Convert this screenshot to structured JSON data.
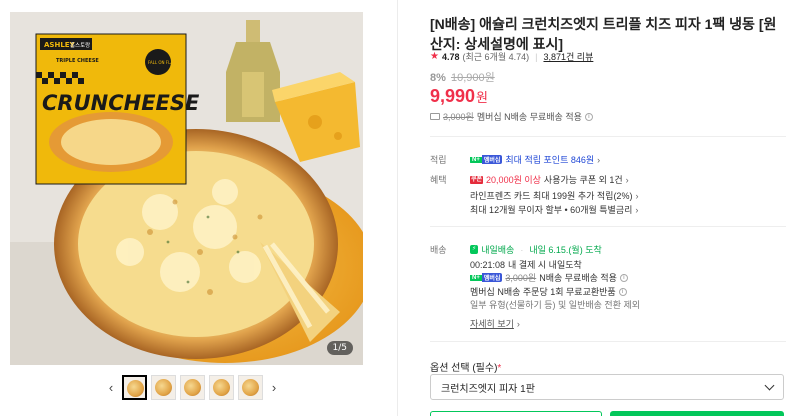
{
  "gallery": {
    "counter": "1/5",
    "prev_icon": "chevron-left-icon",
    "next_icon": "chevron-right-icon",
    "package_brand": "ASHLEY",
    "package_brand_kr": "홈스토랑",
    "package_tag": "TRIPLE CHEESE",
    "package_badge": "FALL ON FLAVOR",
    "package_name": "CRUNCHEESE"
  },
  "product": {
    "title": "[N배송] 애슐리 크런치즈엣지 트리플 치즈 피자 1팩 냉동 [원산지: 상세설명에 표시]",
    "rating": "4.78",
    "rating_recent": "(최근 6개월 4.74)",
    "reviews": "3,871건 리뷰",
    "discount": "8%",
    "original_price": "10,900원",
    "sale_price": "9,990",
    "sale_unit": "원",
    "ship_note_price": "3,000원",
    "ship_note_text": "멤버십 N배송 무료배송 적용"
  },
  "benefits": {
    "accrue_label": "적립",
    "accrue_text": "최대 적립 포인트 846원",
    "perks_label": "혜택",
    "coupon_highlight": "20,000원 이상",
    "coupon_text": "사용가능 쿠폰 외 1건",
    "card_text": "라인프렌즈 카드 최대 199원 추가 적립(2%)",
    "installment_text": "최대 12개월 무이자 할부 • 60개월 특별금리"
  },
  "delivery": {
    "label": "배송",
    "badge": "내일배송",
    "arrival": "내일 6.15.(월) 도착",
    "timer": "00:21:08",
    "timer_text": "내 결제 시 내일도착",
    "free_price": "3,000원",
    "free_text": "N배송 무료배송 적용",
    "exchange_text": "멤버십 N배송 주문당 1회 무료교환반품",
    "exclusion_text": "일부 유형(선물하기 등) 및 일반배송 전환 제외",
    "more_link": "자세히 보기"
  },
  "options": {
    "label": "옵션 선택 (필수)",
    "required_mark": "*",
    "selected": "크런치즈엣지 피자 1판"
  },
  "colors": {
    "price_red": "#f0304a",
    "naver_green": "#03c75a",
    "membership_blue": "#3a57d8",
    "link_blue": "#1f47d6"
  }
}
